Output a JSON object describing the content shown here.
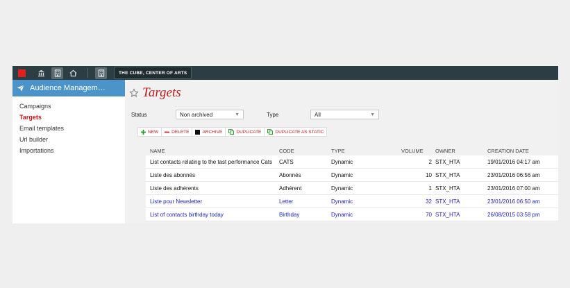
{
  "topbar": {
    "org_label": "THE CUBE, CENTER OF ARTS",
    "brand_color": "#e41d1d",
    "bg_color": "#2c3e44",
    "icons": [
      "institution-icon",
      "building-icon",
      "home-icon",
      "building-icon"
    ]
  },
  "sidebar": {
    "header": "Audience Managem…",
    "header_color": "#4b93c9",
    "items": [
      {
        "label": "Campaigns",
        "active": false
      },
      {
        "label": "Targets",
        "active": true
      },
      {
        "label": "Email templates",
        "active": false
      },
      {
        "label": "Url builder",
        "active": false
      },
      {
        "label": "Importations",
        "active": false
      }
    ]
  },
  "page": {
    "title": "Targets",
    "title_color": "#c21a1a"
  },
  "filters": {
    "status_label": "Status",
    "status_value": "Non archived",
    "type_label": "Type",
    "type_value": "All"
  },
  "toolbar": {
    "new": "NEW",
    "delete": "DELETE",
    "archive": "ARCHIVE",
    "duplicate": "DUPLICATE",
    "duplicate_static": "DUPLICATE AS STATIC"
  },
  "table": {
    "headers": {
      "name": "NAME",
      "code": "CODE",
      "type": "TYPE",
      "volume": "VOLUME",
      "owner": "OWNER",
      "date": "CREATION DATE"
    },
    "rows": [
      {
        "name": "List contacts relating to the tast performance Cats",
        "code": "CATS",
        "type": "Dynamic",
        "volume": "2",
        "owner": "STX_HTA",
        "date": "19/01/2016 04:17 am",
        "link": false
      },
      {
        "name": "Liste des abonnés",
        "code": "Abonnés",
        "type": "Dynamic",
        "volume": "10",
        "owner": "STX_HTA",
        "date": "23/01/2016 06:56 am",
        "link": false
      },
      {
        "name": "Liste des adhérents",
        "code": "Adhérent",
        "type": "Dynamic",
        "volume": "1",
        "owner": "STX_HTA",
        "date": "23/01/2016 07:00 am",
        "link": false
      },
      {
        "name": "Liste pour Newsletter",
        "code": "Letter",
        "type": "Dynamic",
        "volume": "32",
        "owner": "STX_HTA",
        "date": "23/01/2016 06:50 am",
        "link": true
      },
      {
        "name": "List of contacts birthday today",
        "code": "Birthday",
        "type": "Dynamic",
        "volume": "70",
        "owner": "STX_HTA",
        "date": "26/08/2015 03:58 pm",
        "link": true
      }
    ]
  }
}
